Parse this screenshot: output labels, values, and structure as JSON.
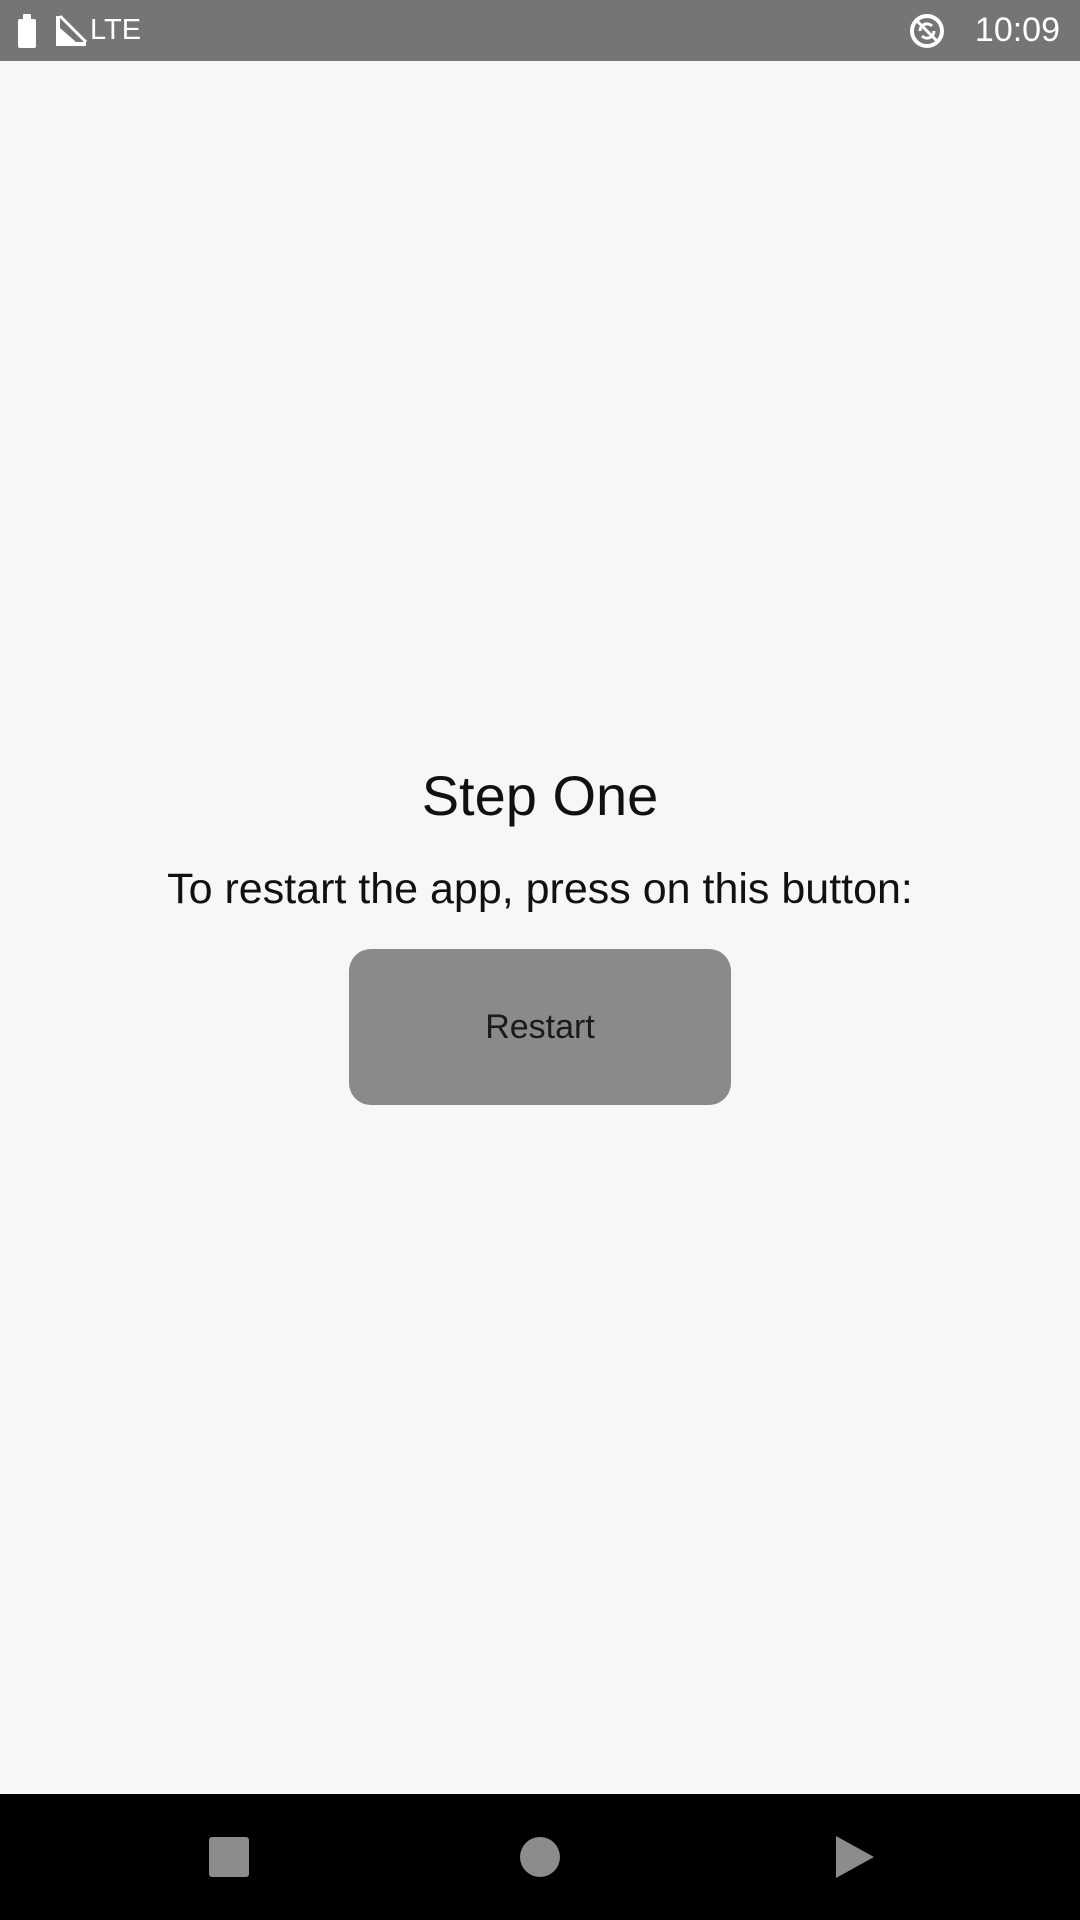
{
  "status_bar": {
    "network_type": "LTE",
    "time": "10:09",
    "icons": [
      "battery-icon",
      "signal-icon",
      "sync-icon"
    ]
  },
  "main": {
    "title": "Step One",
    "instruction": "To restart the app, press on this button:",
    "restart_button_label": "Restart"
  },
  "nav_bar": {
    "icons": [
      "recents-icon",
      "home-icon",
      "back-icon"
    ]
  },
  "colors": {
    "status_bar": "#757575",
    "background": "#f7f7f7",
    "button": "#8a8a8a",
    "nav_bar": "#000000",
    "nav_icons": "#8c8c8c"
  }
}
